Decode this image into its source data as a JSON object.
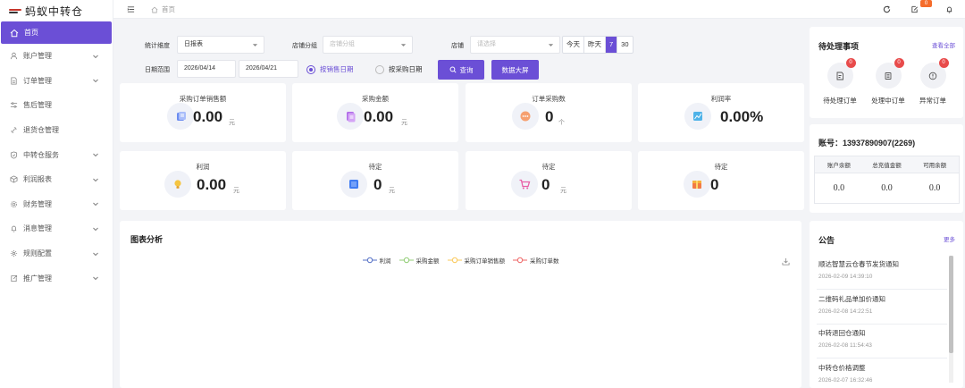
{
  "app": {
    "name": "蚂蚁中转仓"
  },
  "sidebar": {
    "home": "首页",
    "items": [
      {
        "label": "账户管理",
        "icon": "user-icon",
        "has_children": true
      },
      {
        "label": "订单管理",
        "icon": "document-icon",
        "has_children": true
      },
      {
        "label": "售后管理",
        "icon": "sliders-icon",
        "has_children": false
      },
      {
        "label": "退货仓管理",
        "icon": "link-icon",
        "has_children": false
      },
      {
        "label": "中转仓服务",
        "icon": "shield-icon",
        "has_children": true
      },
      {
        "label": "利润报表",
        "icon": "cube-icon",
        "has_children": true
      },
      {
        "label": "财务管理",
        "icon": "gear-icon",
        "has_children": true
      },
      {
        "label": "消息管理",
        "icon": "bell-icon",
        "has_children": true
      },
      {
        "label": "规则配置",
        "icon": "settings-icon",
        "has_children": true
      },
      {
        "label": "推广管理",
        "icon": "share-icon",
        "has_children": true
      }
    ]
  },
  "topbar": {
    "breadcrumb": "首页",
    "message_count": "0"
  },
  "filters": {
    "dimension_label": "统计维度",
    "dimension_value": "日报表",
    "shop_group_label": "店铺分组",
    "shop_group_placeholder": "店铺分组",
    "shop_label": "店铺",
    "shop_placeholder": "请选择",
    "quick_ranges": [
      "今天",
      "昨天",
      "7",
      "30"
    ],
    "quick_active": "7",
    "date_label": "日期范围",
    "date_start": "2026/04/14",
    "date_end": "2026/04/21",
    "radio_sale_date": "按销售日期",
    "radio_purchase_date": "按采购日期",
    "query_button": "查询",
    "dashboard_button": "数据大屏"
  },
  "stats": [
    {
      "label": "采购订单销售额",
      "value": "0.00",
      "unit": "元",
      "icon": "doc-icon"
    },
    {
      "label": "采购金额",
      "value": "0.00",
      "unit": "元",
      "icon": "file-icon"
    },
    {
      "label": "订单采购数",
      "value": "0",
      "unit": "个",
      "icon": "chat-icon"
    },
    {
      "label": "利润率",
      "value": "0.00%",
      "unit": "",
      "icon": "chart-icon"
    },
    {
      "label": "利润",
      "value": "0.00",
      "unit": "元",
      "icon": "bulb-icon"
    },
    {
      "label": "待定",
      "value": "0",
      "unit": "元",
      "icon": "stack-icon"
    },
    {
      "label": "待定",
      "value": "0",
      "unit": "元",
      "icon": "cart-icon"
    },
    {
      "label": "待定",
      "value": "0",
      "unit": "",
      "icon": "box-icon"
    }
  ],
  "chart": {
    "title": "图表分析",
    "legend": [
      {
        "name": "利润",
        "color": "#5470c6"
      },
      {
        "name": "采购金额",
        "color": "#91cc75"
      },
      {
        "name": "采购订单销售额",
        "color": "#fac858"
      },
      {
        "name": "采购订单数",
        "color": "#ee6666"
      }
    ]
  },
  "todo": {
    "title": "待处理事项",
    "link": "查看全部",
    "items": [
      {
        "label": "待处理订单",
        "count": "0"
      },
      {
        "label": "处理中订单",
        "count": "0"
      },
      {
        "label": "异常订单",
        "count": "0"
      }
    ]
  },
  "account": {
    "label": "账号：13937890907(2269)",
    "headers": [
      "账户余额",
      "总充值金额",
      "可用余额"
    ],
    "values": [
      "0.0",
      "0.0",
      "0.0"
    ]
  },
  "notices": {
    "title": "公告",
    "more": "更多",
    "items": [
      {
        "title": "顺达智慧云仓春节发货通知",
        "date": "2026-02-09 14:39:10"
      },
      {
        "title": "二维码礼品单加价通知",
        "date": "2026-02-08 14:22:51"
      },
      {
        "title": "中转退回仓通知",
        "date": "2026-02-08 11:54:43"
      },
      {
        "title": "中转仓价格调整",
        "date": "2026-02-07 16:32:46"
      }
    ]
  },
  "colors": {
    "accent": "#6b4fd6"
  }
}
